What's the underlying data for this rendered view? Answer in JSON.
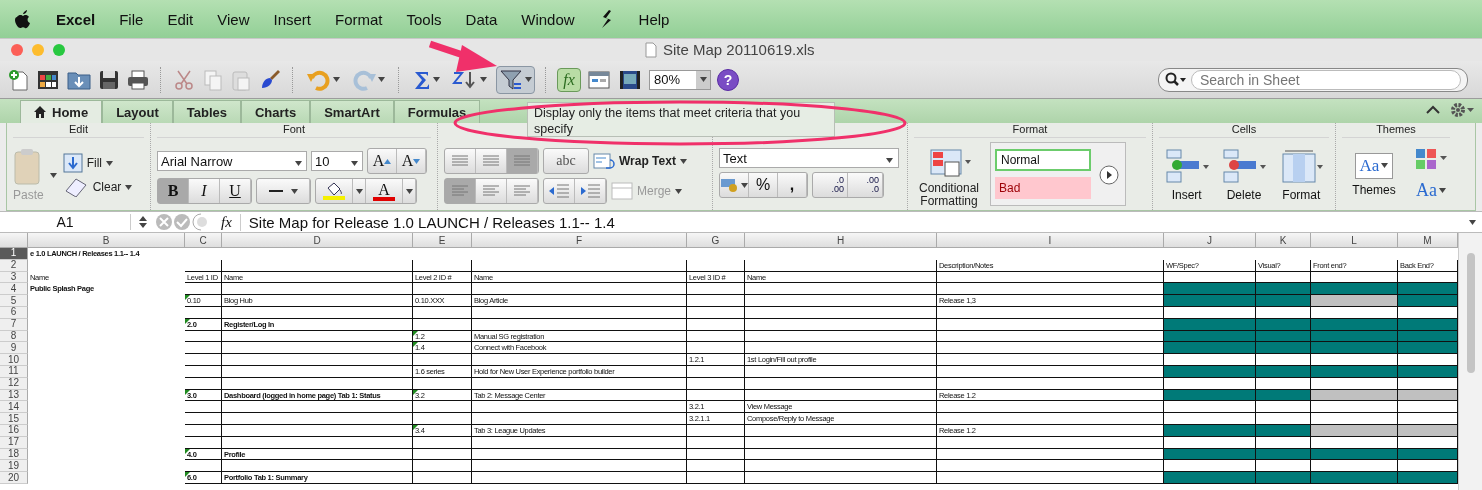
{
  "menu_bar": {
    "items": [
      {
        "label": "Excel",
        "kind": "app"
      },
      {
        "label": "File",
        "kind": "menu"
      },
      {
        "label": "Edit",
        "kind": "menu"
      },
      {
        "label": "View",
        "kind": "menu"
      },
      {
        "label": "Insert",
        "kind": "menu"
      },
      {
        "label": "Format",
        "kind": "menu"
      },
      {
        "label": "Tools",
        "kind": "menu"
      },
      {
        "label": "Data",
        "kind": "menu"
      },
      {
        "label": "Window",
        "kind": "menu"
      },
      {
        "label": "Help",
        "kind": "menu"
      }
    ]
  },
  "window": {
    "title": "Site Map 20110619.xls"
  },
  "toolbar": {
    "filter_button": {
      "hovered": true
    },
    "formula_builder": {
      "label": "fx",
      "on": true
    },
    "zoom": "80%",
    "help": "?",
    "search": {
      "placeholder": "Search in Sheet"
    }
  },
  "tooltip": {
    "text": "Display only the items that meet criteria that you specify"
  },
  "ribbon_tabs": [
    {
      "label": "Home",
      "selected": true
    },
    {
      "label": "Layout",
      "selected": false
    },
    {
      "label": "Tables",
      "selected": false
    },
    {
      "label": "Charts",
      "selected": false
    },
    {
      "label": "SmartArt",
      "selected": false
    },
    {
      "label": "Formulas",
      "selected": false
    }
  ],
  "ribbon": {
    "edit": {
      "title": "Edit",
      "fill": "Fill",
      "clear": "Clear",
      "paste": {
        "label": "Paste",
        "disabled": true
      }
    },
    "font": {
      "title": "Font",
      "name": "Arial Narrow",
      "size": "10",
      "grow": "A",
      "shrink": "A",
      "styles": [
        {
          "label": "B",
          "on": true
        },
        {
          "label": "I",
          "on": false
        },
        {
          "label": "U",
          "on": false
        }
      ],
      "fill_color": {
        "color": "#f5f000"
      },
      "font_color": {
        "label": "A",
        "color": "#e00000"
      }
    },
    "alignment": {
      "vertical": [
        {
          "selected": false
        },
        {
          "selected": false
        },
        {
          "selected": true
        }
      ],
      "horizontal": [
        {
          "selected": true
        },
        {
          "selected": false
        },
        {
          "selected": false
        }
      ],
      "orientation": "abc",
      "wrap_text": "Wrap Text",
      "merge": {
        "label": "Merge",
        "disabled": true
      }
    },
    "number": {
      "format": "Text",
      "percent": "%",
      "comma": ",",
      "decimals": [
        {
          "top": ".0",
          "bottom": ".00"
        },
        {
          "top": ".00",
          "bottom": ".0"
        }
      ]
    },
    "format": {
      "title": "Format",
      "conditional": "Conditional Formatting",
      "styles": [
        {
          "label": "Normal",
          "kind": "normal"
        },
        {
          "label": "Bad",
          "kind": "bad"
        }
      ]
    },
    "cells": {
      "title": "Cells",
      "buttons": [
        "Insert",
        "Delete",
        "Format"
      ]
    },
    "themes": {
      "title": "Themes",
      "label": "Themes",
      "sample": "Aa",
      "fonts": "Aa"
    }
  },
  "formula_bar": {
    "name_box": "A1",
    "fx": "fx",
    "content": "Site Map for Release 1.0 LAUNCH / Releases 1.1-- 1.4"
  },
  "sheet": {
    "columns": [
      "B",
      "C",
      "D",
      "E",
      "F",
      "G",
      "H",
      "I",
      "J",
      "K",
      "L",
      "M"
    ],
    "rows": [
      {
        "number": "1",
        "selected": true,
        "cells": [
          {
            "text": "e 1.0 LAUNCH / Releases 1.1-- 1.4",
            "bold": true,
            "note": false
          }
        ]
      },
      {
        "number": "2",
        "selected": false,
        "cells": [
          {
            "text": ""
          },
          {
            "text": ""
          },
          {
            "text": ""
          },
          {
            "text": ""
          },
          {
            "text": ""
          },
          {
            "text": ""
          },
          {
            "text": ""
          },
          {
            "text": "Description/Notes",
            "bold": false,
            "note": false
          },
          {
            "text": "WF/Spec?",
            "bold": false,
            "note": false
          },
          {
            "text": "Visual?",
            "bold": false,
            "note": false
          },
          {
            "text": "Front end?",
            "bold": false,
            "note": false
          },
          {
            "text": "Back End?",
            "bold": false,
            "note": false
          }
        ]
      },
      {
        "number": "3",
        "selected": false,
        "cells": [
          {
            "text": "Name",
            "bold": false,
            "note": false
          },
          {
            "text": "Level 1 ID",
            "bold": false,
            "note": false
          },
          {
            "text": "Name",
            "bold": false,
            "note": false
          },
          {
            "text": "Level 2 ID #",
            "bold": false,
            "note": false
          },
          {
            "text": "Name",
            "bold": false,
            "note": false
          },
          {
            "text": "Level 3 ID #",
            "bold": false,
            "note": false
          },
          {
            "text": "Name",
            "bold": false,
            "note": false
          }
        ]
      },
      {
        "number": "4",
        "selected": false,
        "cells": [
          {
            "text": "Public Splash Page",
            "bold": true,
            "note": false
          }
        ],
        "status": [
          {
            "color": "#007a78"
          },
          {
            "color": "#007a78"
          },
          {
            "color": "#007a78"
          },
          {
            "color": "#007a78"
          }
        ]
      },
      {
        "number": "5",
        "selected": false,
        "cells": [
          {
            "text": ""
          },
          {
            "text": "0.10",
            "bold": false,
            "note": true
          },
          {
            "text": "Blog Hub",
            "bold": false,
            "note": false
          },
          {
            "text": "0.10.XXX",
            "bold": false,
            "note": false
          },
          {
            "text": "Blog Article",
            "bold": false,
            "note": false
          },
          {
            "text": ""
          },
          {
            "text": ""
          },
          {
            "text": "Release 1,3",
            "bold": false,
            "note": false
          }
        ],
        "status": [
          {
            "color": "#007a78"
          },
          {
            "color": "#007a78"
          },
          {
            "color": "#c0c0c0"
          },
          {
            "color": "#007a78"
          }
        ]
      },
      {
        "number": "6",
        "selected": false
      },
      {
        "number": "7",
        "selected": false,
        "cells": [
          {
            "text": ""
          },
          {
            "text": "2.0",
            "bold": true,
            "note": true
          },
          {
            "text": "Register/Log In",
            "bold": true,
            "note": false
          }
        ],
        "status": [
          {
            "color": "#007a78"
          },
          {
            "color": "#007a78"
          },
          {
            "color": "#007a78"
          },
          {
            "color": "#007a78"
          }
        ]
      },
      {
        "number": "8",
        "selected": false,
        "cells": [
          {
            "text": ""
          },
          {
            "text": ""
          },
          {
            "text": ""
          },
          {
            "text": "1.2",
            "bold": false,
            "note": true
          },
          {
            "text": "Manual SG registration",
            "bold": false,
            "note": false
          }
        ],
        "status": [
          {
            "color": "#007a78"
          },
          {
            "color": "#007a78"
          },
          {
            "color": "#007a78"
          },
          {
            "color": "#007a78"
          }
        ]
      },
      {
        "number": "9",
        "selected": false,
        "cells": [
          {
            "text": ""
          },
          {
            "text": ""
          },
          {
            "text": ""
          },
          {
            "text": "1.4",
            "bold": false,
            "note": true
          },
          {
            "text": "Connect with Facebook",
            "bold": false,
            "note": false
          }
        ],
        "status": [
          {
            "color": "#007a78"
          },
          {
            "color": "#007a78"
          },
          {
            "color": "#007a78"
          },
          {
            "color": "#007a78"
          }
        ]
      },
      {
        "number": "10",
        "selected": false,
        "cells": [
          {
            "text": ""
          },
          {
            "text": ""
          },
          {
            "text": ""
          },
          {
            "text": ""
          },
          {
            "text": ""
          },
          {
            "text": "1.2.1",
            "bold": false,
            "note": false
          },
          {
            "text": "1st Login/Fill out profile",
            "bold": false,
            "note": false
          }
        ]
      },
      {
        "number": "11",
        "selected": false,
        "cells": [
          {
            "text": ""
          },
          {
            "text": ""
          },
          {
            "text": ""
          },
          {
            "text": "1.6 series",
            "bold": false,
            "note": false
          },
          {
            "text": "Hold for New User Experience portfolio builder",
            "bold": false,
            "note": false
          }
        ],
        "status": [
          {
            "color": "#007a78"
          },
          {
            "color": "#007a78"
          },
          {
            "color": "#007a78"
          },
          {
            "color": "#007a78"
          }
        ]
      },
      {
        "number": "12",
        "selected": false
      },
      {
        "number": "13",
        "selected": false,
        "cells": [
          {
            "text": ""
          },
          {
            "text": "3.0",
            "bold": true,
            "note": true
          },
          {
            "text": "Dashboard (logged in home page) Tab 1: Status",
            "bold": true,
            "note": false
          },
          {
            "text": "3.2",
            "bold": false,
            "note": true
          },
          {
            "text": "Tab 2: Message Center",
            "bold": false,
            "note": false
          },
          {
            "text": ""
          },
          {
            "text": ""
          },
          {
            "text": "Release 1.2",
            "bold": false,
            "note": false
          }
        ],
        "status": [
          {
            "color": "#007a78"
          },
          {
            "color": "#007a78"
          },
          {
            "color": "#c0c0c0"
          },
          {
            "color": "#c0c0c0"
          }
        ]
      },
      {
        "number": "14",
        "selected": false,
        "cells": [
          {
            "text": ""
          },
          {
            "text": ""
          },
          {
            "text": ""
          },
          {
            "text": ""
          },
          {
            "text": ""
          },
          {
            "text": "3.2.1",
            "bold": false,
            "note": false
          },
          {
            "text": "View Message",
            "bold": false,
            "note": false
          }
        ]
      },
      {
        "number": "15",
        "selected": false,
        "cells": [
          {
            "text": ""
          },
          {
            "text": ""
          },
          {
            "text": ""
          },
          {
            "text": ""
          },
          {
            "text": ""
          },
          {
            "text": "3.2.1.1",
            "bold": false,
            "note": false
          },
          {
            "text": "Compose/Reply to Message",
            "bold": false,
            "note": false
          }
        ]
      },
      {
        "number": "16",
        "selected": false,
        "cells": [
          {
            "text": ""
          },
          {
            "text": ""
          },
          {
            "text": ""
          },
          {
            "text": "3.4",
            "bold": false,
            "note": true
          },
          {
            "text": "Tab 3: League Updates",
            "bold": false,
            "note": false
          },
          {
            "text": ""
          },
          {
            "text": ""
          },
          {
            "text": "Release 1.2",
            "bold": false,
            "note": false
          }
        ],
        "status": [
          {
            "color": "#007a78"
          },
          {
            "color": "#007a78"
          },
          {
            "color": "#c0c0c0"
          },
          {
            "color": "#c0c0c0"
          }
        ]
      },
      {
        "number": "17",
        "selected": false
      },
      {
        "number": "18",
        "selected": false,
        "cells": [
          {
            "text": ""
          },
          {
            "text": "4.0",
            "bold": true,
            "note": true
          },
          {
            "text": "Profile",
            "bold": true,
            "note": false
          }
        ],
        "status": [
          {
            "color": "#007a78"
          },
          {
            "color": "#007a78"
          },
          {
            "color": "#007a78"
          },
          {
            "color": "#007a78"
          }
        ]
      },
      {
        "number": "19",
        "selected": false
      },
      {
        "number": "20",
        "selected": false,
        "cells": [
          {
            "text": ""
          },
          {
            "text": "6.0",
            "bold": true,
            "note": true
          },
          {
            "text": "Portfolio Tab 1: Summary",
            "bold": true,
            "note": false
          }
        ],
        "status": [
          {
            "color": "#007a78"
          },
          {
            "color": "#007a78"
          },
          {
            "color": "#007a78"
          },
          {
            "color": "#007a78"
          }
        ]
      }
    ]
  }
}
